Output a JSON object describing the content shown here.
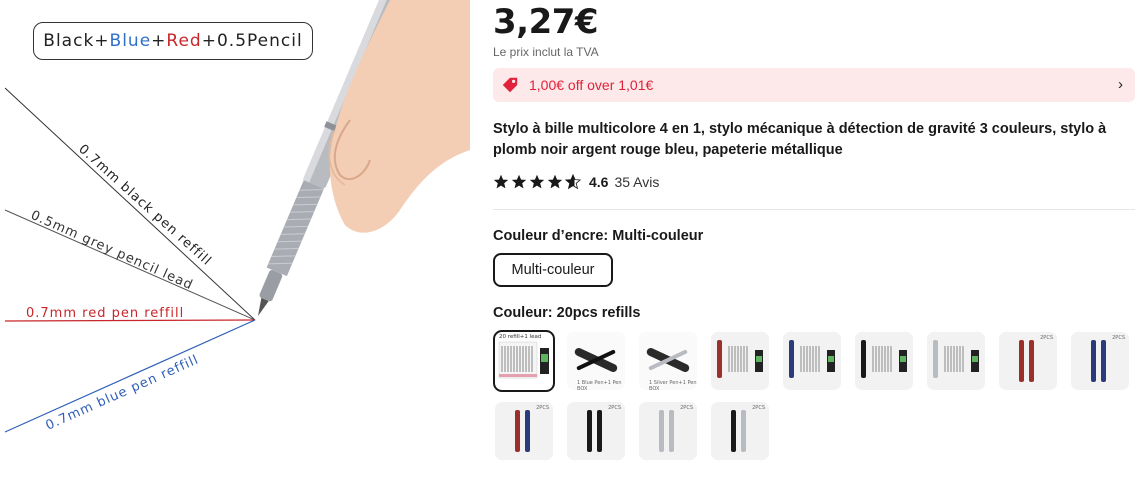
{
  "hero": {
    "badge": {
      "black": "Black",
      "plus": "+",
      "blue": "Blue",
      "red": "Red",
      "pencil": "+0.5Pencil"
    },
    "callouts": {
      "black": "0.7mm black pen reffill",
      "grey": "0.5mm grey pencil lead",
      "red": "0.7mm red pen reffill",
      "blue": "0.7mm blue pen reffill"
    },
    "colors": {
      "black": "#222222",
      "grey": "#444444",
      "red": "#c8262a",
      "blue": "#2f5fb8"
    }
  },
  "product": {
    "price": "3,27€",
    "vat_note": "Le prix inclut la TVA",
    "coupon": {
      "text": "1,00€ off over 1,01€",
      "icon": "tag-icon",
      "color": "#e0233a"
    },
    "title": "Stylo à bille multicolore 4 en 1, stylo mécanique à détection de gravité 3 couleurs, stylo à plomb noir argent rouge bleu, papeterie métallique",
    "rating": {
      "stars": 4.6,
      "value": "4.6",
      "count": "35 Avis"
    }
  },
  "options": {
    "ink_label": "Couleur d’encre: Multi-couleur",
    "ink_choice": "Multi-couleur",
    "color_label": "Couleur: 20pcs refills",
    "thumb_texts": {
      "refill_head": "20 refill+1 lead",
      "box1": "1 Blue Pen+1 Pen BOX",
      "box2": "1 Silver Pen+1 Pen BOX",
      "pcs": "2PCS"
    },
    "variants": [
      {
        "name": "20pcs refills",
        "selected": true
      },
      {
        "name": "black pen with box"
      },
      {
        "name": "silver pen with box"
      },
      {
        "name": "red pen with refills"
      },
      {
        "name": "blue pen with refills"
      },
      {
        "name": "black pen with refills"
      },
      {
        "name": "silver pen with refills"
      },
      {
        "name": "2pcs red"
      },
      {
        "name": "2pcs blue"
      },
      {
        "name": "2pcs red blue"
      },
      {
        "name": "2pcs black"
      },
      {
        "name": "2pcs silver"
      },
      {
        "name": "2pcs black silver"
      }
    ]
  }
}
